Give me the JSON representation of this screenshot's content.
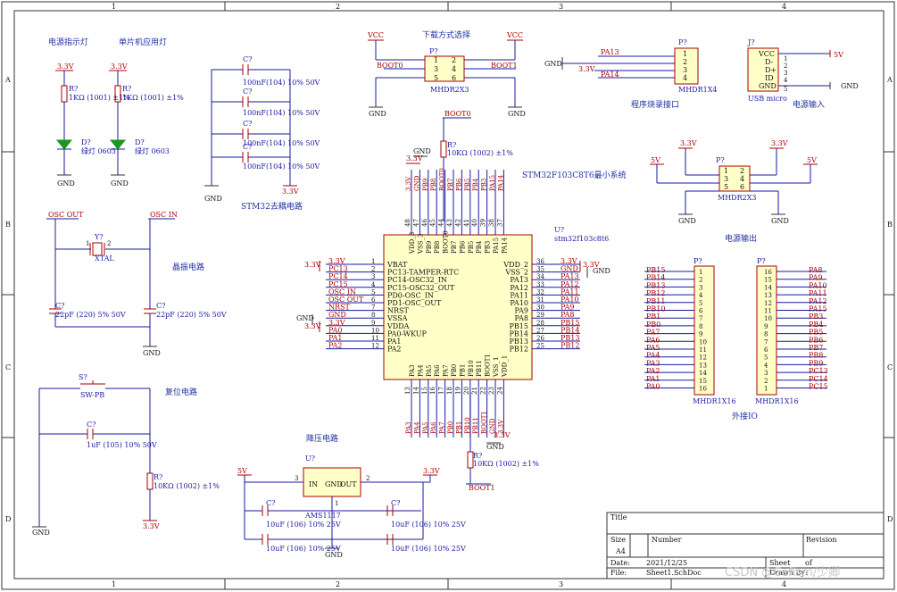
{
  "frame": {
    "col_numbers": [
      "1",
      "2",
      "3",
      "4"
    ],
    "row_letters": [
      "A",
      "B",
      "C",
      "D"
    ]
  },
  "sections": {
    "power_led": "电源指示灯",
    "mcu_led": "单片机应用灯",
    "download_mode": "下载方式选择",
    "prog_port": "程序烧录接口",
    "power_in": "电源输入",
    "decoupling": "STM32去耦电路",
    "min_system": "STM32F103C8T6最小系统",
    "crystal": "晶振电路",
    "power_out": "电源输出",
    "reset": "复位电路",
    "ext_io": "外接IO",
    "ldo": "降压电路"
  },
  "leds": [
    {
      "rail": "3.3V",
      "res_ref": "R?",
      "res_val": "1KΩ (1001) ±1%",
      "led_ref": "D?",
      "led_val": "绿灯 0603",
      "gnd": "GND"
    },
    {
      "rail": "3.3V",
      "res_ref": "R?",
      "res_val": "1KΩ (1001) ±1%",
      "led_ref": "D?",
      "led_val": "绿灯 0603",
      "gnd": "GND"
    }
  ],
  "decoupling": {
    "ref": "C?",
    "caps": [
      "100nF(104) 10% 50V",
      "100nF(104) 10% 50V",
      "100nF(104) 10% 50V",
      "100nF(104) 10% 50V"
    ],
    "rail": "3.3V",
    "gnd": "GND"
  },
  "boot_header": {
    "ref": "P?",
    "part": "MHDR2X3",
    "vcc_left": "VCC",
    "vcc_right": "VCC",
    "pins": [
      "1",
      "2",
      "3",
      "4",
      "5",
      "6"
    ],
    "net_left": "BOOT0",
    "net_right": "BOOT1",
    "net_bottom": "BOOT0",
    "gnd": "GND"
  },
  "boot_res": {
    "ref": "R?",
    "val": "10KΩ (1002) ±1%"
  },
  "prog_header": {
    "ref": "P?",
    "part": "MHDR1X4",
    "pins": [
      "1",
      "2",
      "3",
      "4"
    ],
    "nets": [
      "PA13",
      "3.3V",
      "PA14"
    ],
    "gnd": "GND"
  },
  "usb": {
    "ref": "J?",
    "part": "USB micro",
    "pins": [
      "VCC",
      "D-",
      "D+",
      "ID",
      "GND"
    ],
    "pin_nums": [
      "1",
      "2",
      "3",
      "4",
      "5"
    ],
    "rail": "5V",
    "gnd": "GND"
  },
  "out_header": {
    "ref": "P?",
    "part": "MHDR2X3",
    "pins": [
      "1",
      "2",
      "3",
      "4",
      "5",
      "6"
    ],
    "rails": [
      "5V",
      "3.3V",
      "3.3V",
      "5V"
    ],
    "gnd": "GND"
  },
  "mcu": {
    "ref": "U?",
    "part": "stm32f103c8t6",
    "left_pins": [
      {
        "num": "1",
        "name": "VBAT",
        "net": "3.3V"
      },
      {
        "num": "2",
        "name": "PC13-TAMPER-RTC",
        "net": "PC13"
      },
      {
        "num": "3",
        "name": "PC14-OSC32_IN",
        "net": "PC14"
      },
      {
        "num": "4",
        "name": "PC15-OSC32_OUT",
        "net": "PC15"
      },
      {
        "num": "5",
        "name": "PD0-OSC_IN",
        "net": "OSC IN"
      },
      {
        "num": "6",
        "name": "PD1-OSC_OUT",
        "net": "OSC OUT"
      },
      {
        "num": "7",
        "name": "NRST",
        "net": "NRST"
      },
      {
        "num": "8",
        "name": "VSSA",
        "net": "GND"
      },
      {
        "num": "9",
        "name": "VDDA",
        "net": "3.3V"
      },
      {
        "num": "10",
        "name": "PA0-WKUP",
        "net": "PA0"
      },
      {
        "num": "11",
        "name": "PA1",
        "net": "PA1"
      },
      {
        "num": "12",
        "name": "PA2",
        "net": "PA2"
      }
    ],
    "right_pins": [
      {
        "num": "36",
        "name": "VDD_2",
        "net": "3.3V"
      },
      {
        "num": "35",
        "name": "VSS_2",
        "net": "GND"
      },
      {
        "num": "34",
        "name": "PA13",
        "net": "PA13"
      },
      {
        "num": "33",
        "name": "PA12",
        "net": "PA12"
      },
      {
        "num": "32",
        "name": "PA11",
        "net": "PA11"
      },
      {
        "num": "31",
        "name": "PA10",
        "net": "PA10"
      },
      {
        "num": "30",
        "name": "PA9",
        "net": "PA9"
      },
      {
        "num": "29",
        "name": "PA8",
        "net": "PA8"
      },
      {
        "num": "28",
        "name": "PB15",
        "net": "PB15"
      },
      {
        "num": "27",
        "name": "PB14",
        "net": "PB14"
      },
      {
        "num": "26",
        "name": "PB13",
        "net": "PB13"
      },
      {
        "num": "25",
        "name": "PB12",
        "net": "PB12"
      }
    ],
    "top_pins": [
      {
        "num": "48",
        "name": "VDD_3",
        "net": "3.3V"
      },
      {
        "num": "47",
        "name": "VSS_3",
        "net": "GND"
      },
      {
        "num": "46",
        "name": "PB9",
        "net": "PB9"
      },
      {
        "num": "45",
        "name": "PB8",
        "net": "PB8"
      },
      {
        "num": "44",
        "name": "BOOT0",
        "net": "BOOT0"
      },
      {
        "num": "43",
        "name": "PB7",
        "net": "PB7"
      },
      {
        "num": "42",
        "name": "PB6",
        "net": "PB6"
      },
      {
        "num": "41",
        "name": "PB5",
        "net": "PB5"
      },
      {
        "num": "40",
        "name": "PB4",
        "net": "PB4"
      },
      {
        "num": "39",
        "name": "PB3",
        "net": "PB3"
      },
      {
        "num": "38",
        "name": "PA15",
        "net": "PA15"
      },
      {
        "num": "37",
        "name": "PA14",
        "net": "PA14"
      }
    ],
    "bottom_pins": [
      {
        "num": "13",
        "name": "PA3",
        "net": "PA3"
      },
      {
        "num": "14",
        "name": "PA4",
        "net": "PA4"
      },
      {
        "num": "15",
        "name": "PA5",
        "net": "PA5"
      },
      {
        "num": "16",
        "name": "PA6",
        "net": "PA6"
      },
      {
        "num": "17",
        "name": "PA7",
        "net": "PA7"
      },
      {
        "num": "18",
        "name": "PB0",
        "net": "PB0"
      },
      {
        "num": "19",
        "name": "PB1",
        "net": "PB1"
      },
      {
        "num": "20",
        "name": "PB10",
        "net": "PB10"
      },
      {
        "num": "21",
        "name": "PB11",
        "net": "PB11"
      },
      {
        "num": "22",
        "name": "BOOT1",
        "net": "BOOT1"
      },
      {
        "num": "23",
        "name": "VSS_1",
        "net": "GND"
      },
      {
        "num": "24",
        "name": "VDD_1",
        "net": "3.3V"
      }
    ],
    "pwr_left_top": "3.3V",
    "gnd_left": "GND",
    "pwr_left_mid": "3.3V",
    "pwr_right": "3.3V",
    "gnd_right": "GND",
    "pwr_top": "3.3V",
    "gnd_top": "GND",
    "gnd_bottom": "GND",
    "pwr_bottom": "3.3V"
  },
  "crystal": {
    "osc_out": "OSC OUT",
    "osc_in": "OSC IN",
    "y_ref": "Y?",
    "y_val": "XTAL",
    "c_ref": "C?",
    "c_val": "22pF (220) 5% 50V",
    "pin1": "1",
    "pin2": "2",
    "gnd": "GND"
  },
  "reset": {
    "sw_ref": "S?",
    "sw_val": "SW-PB",
    "c_ref": "C?",
    "c_val": "1uF (105) 10% 50V",
    "r_ref": "R?",
    "r_val": "10KΩ (1002) ±1%",
    "rail": "3.3V",
    "gnd": "GND"
  },
  "boot1_res": {
    "ref": "R?",
    "val": "10KΩ (1002) ±1%",
    "net": "BOOT1",
    "gnd": "GND"
  },
  "ldo": {
    "ref": "U?",
    "part": "AMS1117",
    "pins": [
      "IN",
      "GND",
      "OUT"
    ],
    "pin_nums": [
      "3",
      "1",
      "2"
    ],
    "in_rail": "5V",
    "out_rail": "3.3V",
    "c_ref": "C?",
    "c_val": "10uF (106) 10% 25V",
    "gnd": "GND"
  },
  "io_left": {
    "ref": "P?",
    "part": "MHDR1X16",
    "nets": [
      "PB15",
      "PB14",
      "PB13",
      "PB12",
      "PB11",
      "PB10",
      "PB1",
      "PB0",
      "PA7",
      "PA6",
      "PA5",
      "PA4",
      "PA3",
      "PA2",
      "PA1",
      "PA0"
    ]
  },
  "io_right": {
    "ref": "P?",
    "part": "MHDR1X16",
    "nets": [
      "PA8",
      "PA9",
      "PA10",
      "PA11",
      "PA12",
      "PA15",
      "PB3",
      "PB4",
      "PB5",
      "PB6",
      "PB7",
      "PB8",
      "PB9",
      "PC13",
      "PC14",
      "PC15"
    ]
  },
  "title_block": {
    "title_label": "Title",
    "size_label": "Size",
    "size_value": "A4",
    "number_label": "Number",
    "revision_label": "Revision",
    "date_label": "Date:",
    "date_value": "2021/12/25",
    "sheet_label": "Sheet",
    "sheet_of": "of",
    "file_label": "File:",
    "file_value": "Sheet1.SchDoc",
    "drawn_label": "Drawn By:"
  },
  "watermark": "CSDN @Cefism/少卿"
}
